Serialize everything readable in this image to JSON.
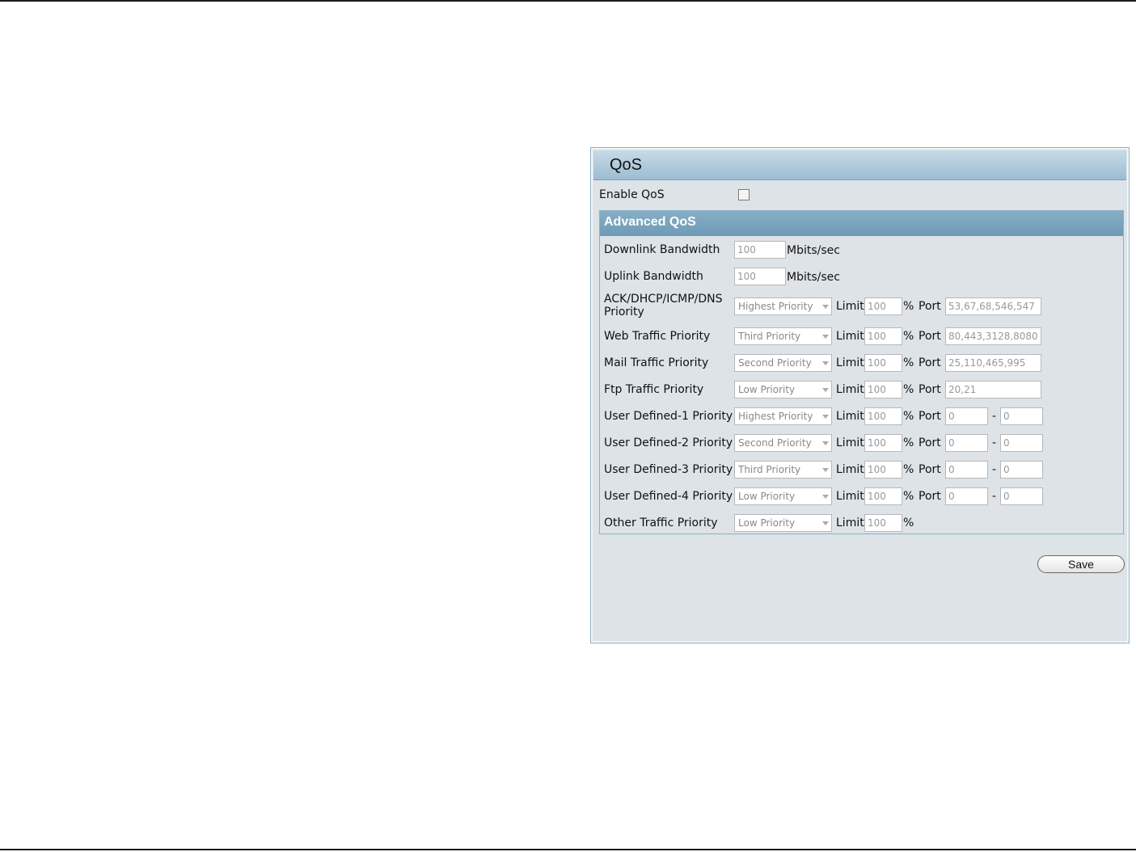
{
  "panel": {
    "title": "QoS",
    "enable_label": "Enable QoS",
    "enable_checked": false
  },
  "advanced": {
    "title": "Advanced QoS",
    "downlink": {
      "label": "Downlink Bandwidth",
      "value": "100",
      "unit": "Mbits/sec"
    },
    "uplink": {
      "label": "Uplink Bandwidth",
      "value": "100",
      "unit": "Mbits/sec"
    },
    "limit_label": "Limit",
    "percent_label": "%",
    "port_label": "Port",
    "dash": "-",
    "rows": [
      {
        "label": "ACK/DHCP/ICMP/DNS",
        "label2": "Priority",
        "priority": "Highest Priority",
        "limit": "100",
        "port": "53,67,68,546,547"
      },
      {
        "label": "Web Traffic Priority",
        "priority": "Third Priority",
        "limit": "100",
        "port": "80,443,3128,8080"
      },
      {
        "label": "Mail Traffic Priority",
        "priority": "Second Priority",
        "limit": "100",
        "port": "25,110,465,995"
      },
      {
        "label": "Ftp Traffic Priority",
        "priority": "Low Priority",
        "limit": "100",
        "port": "20,21"
      },
      {
        "label": "User Defined-1 Priority",
        "priority": "Highest Priority",
        "limit": "100",
        "port_from": "0",
        "port_to": "0"
      },
      {
        "label": "User Defined-2 Priority",
        "priority": "Second Priority",
        "limit": "100",
        "port_from": "0",
        "port_to": "0"
      },
      {
        "label": "User Defined-3 Priority",
        "priority": "Third Priority",
        "limit": "100",
        "port_from": "0",
        "port_to": "0"
      },
      {
        "label": "User Defined-4 Priority",
        "priority": "Low Priority",
        "limit": "100",
        "port_from": "0",
        "port_to": "0"
      },
      {
        "label": "Other Traffic Priority",
        "priority": "Low Priority",
        "limit": "100"
      }
    ]
  },
  "save_label": "Save"
}
